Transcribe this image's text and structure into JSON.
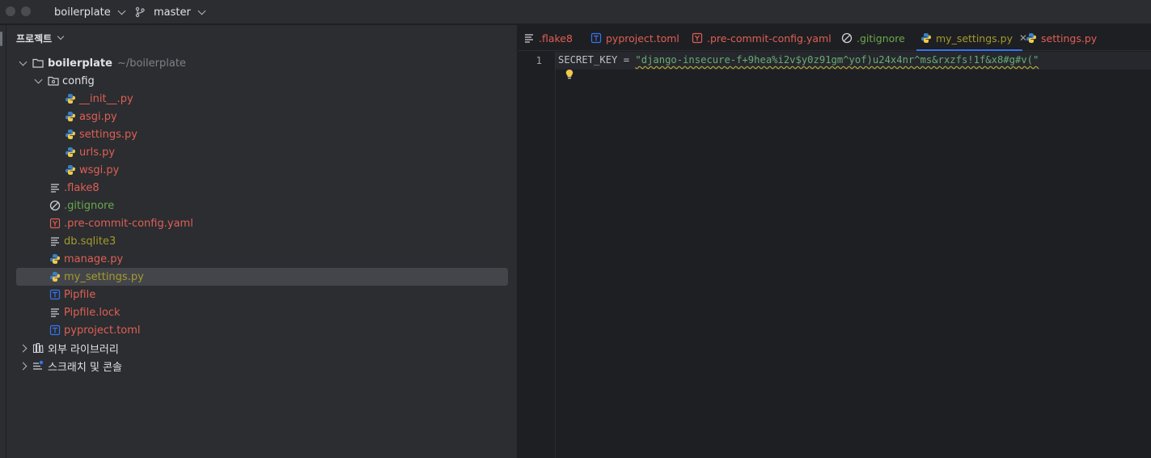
{
  "titlebar": {
    "project_name": "boilerplate",
    "branch": "master"
  },
  "project_panel": {
    "header": "프로젝트",
    "root": {
      "name": "boilerplate",
      "path": "~/boilerplate"
    },
    "config_folder": "config",
    "config_files": [
      "__init__.py",
      "asgi.py",
      "settings.py",
      "urls.py",
      "wsgi.py"
    ],
    "root_files": [
      ".flake8",
      ".gitignore",
      ".pre-commit-config.yaml",
      "db.sqlite3",
      "manage.py",
      "my_settings.py",
      "Pipfile",
      "Pipfile.lock",
      "pyproject.toml"
    ],
    "external_libraries": "외부 라이브러리",
    "scratches": "스크래치 및 콘솔"
  },
  "editor": {
    "tabs": [
      ".flake8",
      "pyproject.toml",
      ".pre-commit-config.yaml",
      ".gitignore",
      "my_settings.py",
      "settings.py"
    ],
    "active_tab": "my_settings.py",
    "line_number": "1",
    "code": {
      "variable": "SECRET_KEY",
      "operator": " = ",
      "value": "\"django-insecure-f+9hea%i2v$y0z91gm^yof)u24x4nr^ms&rxzfs!1f&x8#g#v(\""
    }
  },
  "colors": {
    "accent": "#3574f0",
    "modified_red": "#e05f56",
    "ignored_olive": "#a39b2d",
    "gitignore_green": "#6aa84f",
    "string_green": "#6aab73"
  }
}
